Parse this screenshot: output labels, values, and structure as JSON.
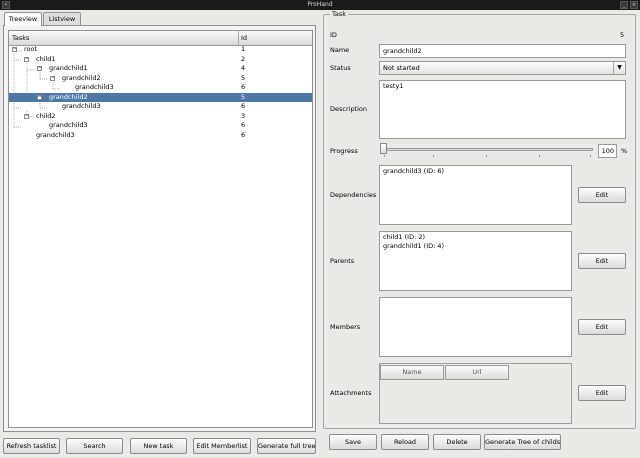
{
  "window": {
    "title": "ProHand"
  },
  "tabs": [
    {
      "label": "Treeview"
    },
    {
      "label": "Listview"
    }
  ],
  "tree": {
    "headers": {
      "tasks": "Tasks",
      "id": "Id"
    },
    "rows": [
      {
        "name": "root",
        "id": "1",
        "expander": "−"
      },
      {
        "name": "child1",
        "id": "2",
        "expander": "−"
      },
      {
        "name": "grandchild1",
        "id": "4",
        "expander": "−"
      },
      {
        "name": "grandchild2",
        "id": "5",
        "expander": "−"
      },
      {
        "name": "grandchild3",
        "id": "6"
      },
      {
        "name": "grandchild2",
        "id": "5",
        "expander": "−",
        "selected": true
      },
      {
        "name": "grandchild3",
        "id": "6"
      },
      {
        "name": "child2",
        "id": "3",
        "expander": "−"
      },
      {
        "name": "grandchild3",
        "id": "6"
      },
      {
        "name": "grandchild3",
        "id": "6"
      }
    ]
  },
  "left_buttons": {
    "refresh": "Refresh tasklist",
    "search": "Search",
    "new_task": "New task",
    "edit_memberlist": "Edit Memberlist",
    "generate_full_tree": "Generate full tree"
  },
  "task": {
    "group_title": "Task",
    "id_label": "ID",
    "id_value": "5",
    "name_label": "Name",
    "name_value": "grandchild2",
    "status_label": "Status",
    "status_value": "Not started",
    "description_label": "Description",
    "description_value": "testy1",
    "progress_label": "Progress",
    "progress_value": "100",
    "progress_fraction": 0,
    "progress_unit": "%",
    "dependencies_label": "Dependencies",
    "dependencies": [
      "grandchild3 (ID: 6)"
    ],
    "parents_label": "Parents",
    "parents": [
      "child1 (ID: 2)",
      "grandchild1 (ID: 4)"
    ],
    "members_label": "Members",
    "members": [],
    "attachments_label": "Attachments",
    "attachment_columns": {
      "name": "Name",
      "url": "Url"
    },
    "edit_label": "Edit"
  },
  "bottom_buttons": {
    "save": "Save",
    "reload": "Reload",
    "delete": "Delete",
    "generate_tree": "Generate Tree of childs"
  },
  "colors": {
    "selection": "#4e78a6",
    "window_bg": "#e9e9e6",
    "titlebar": "#1a1a1a"
  }
}
